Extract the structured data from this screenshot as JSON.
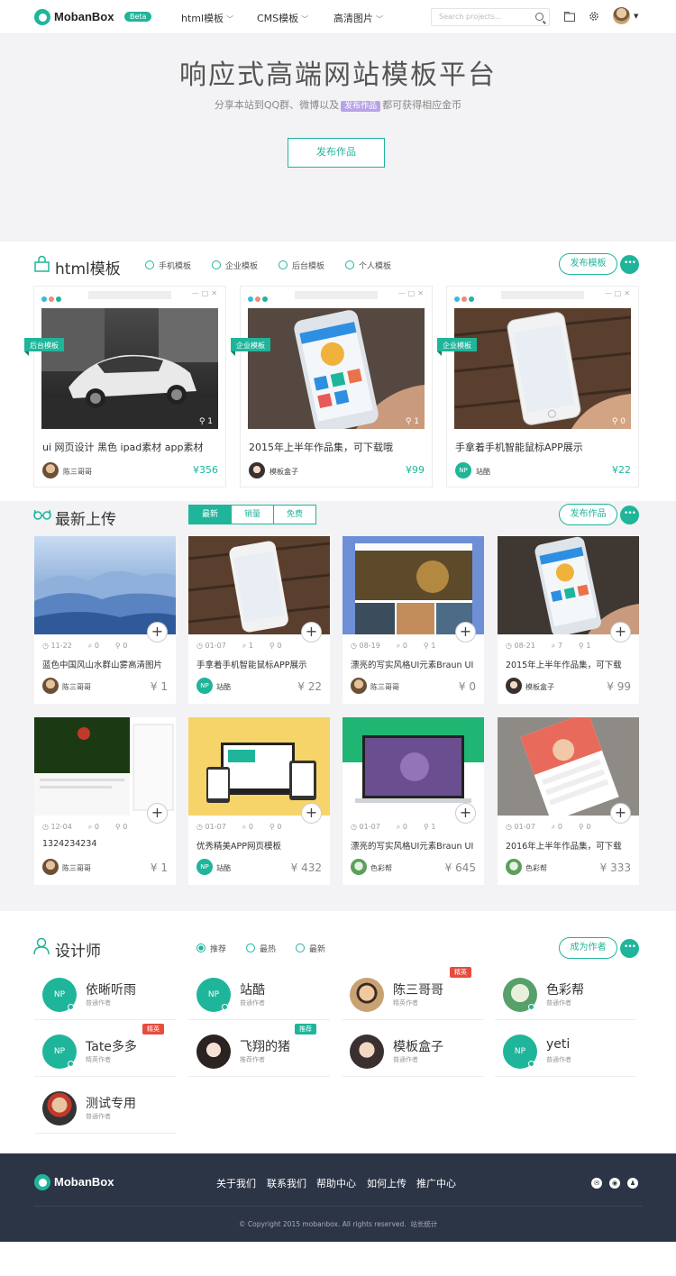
{
  "header": {
    "brand": "MobanBox",
    "beta": "Beta",
    "nav": [
      {
        "label": "html模板"
      },
      {
        "label": "CMS模板"
      },
      {
        "label": "高清图片"
      }
    ],
    "search_placeholder": "Search projects..."
  },
  "hero": {
    "title": "响应式高端网站模板平台",
    "sub_before": "分享本站到QQ群、微博以及",
    "sub_tag": "发布作品",
    "sub_after": "都可获得相应金币",
    "button": "发布作品"
  },
  "templates": {
    "title": "html模板",
    "filters": [
      "手机模板",
      "企业模板",
      "后台模板",
      "个人模板"
    ],
    "button": "发布模板",
    "more": "•••",
    "cards": [
      {
        "ribbon": "后台模板",
        "likes": "1",
        "title": "ui 网页设计 黑色 ipad素材 app素材",
        "author": "陈三哥哥",
        "price": "¥356"
      },
      {
        "ribbon": "企业模板",
        "likes": "1",
        "title": "2015年上半年作品集，可下载哦",
        "author": "模板盒子",
        "price": "¥99"
      },
      {
        "ribbon": "企业模板",
        "likes": "0",
        "title": "手拿着手机智能鼠标APP展示",
        "author": "站酷",
        "avatar": "NP",
        "price": "¥22"
      }
    ]
  },
  "latest": {
    "title": "最新上传",
    "tabs": [
      "最新",
      "销量",
      "免费"
    ],
    "button": "发布作品",
    "more": "•••",
    "cards": [
      {
        "date": "11-22",
        "comments": "0",
        "likes": "0",
        "title": "蓝色中国风山水群山雾高清图片",
        "author": "陈三哥哥",
        "price": "¥ 1"
      },
      {
        "date": "01-07",
        "comments": "1",
        "likes": "0",
        "title": "手拿着手机智能鼠标APP展示",
        "author": "站酷",
        "avatar": "NP",
        "price": "¥ 22"
      },
      {
        "date": "08-19",
        "comments": "0",
        "likes": "1",
        "title": "漂亮的写实风格UI元素Braun UI",
        "author": "陈三哥哥",
        "price": "¥ 0"
      },
      {
        "date": "08-21",
        "comments": "7",
        "likes": "1",
        "title": "2015年上半年作品集，可下载",
        "author": "模板盒子",
        "price": "¥ 99"
      },
      {
        "date": "12-04",
        "comments": "0",
        "likes": "0",
        "title": "1324234234",
        "author": "陈三哥哥",
        "price": "¥ 1"
      },
      {
        "date": "01-07",
        "comments": "0",
        "likes": "0",
        "title": "优秀精美APP网页模板",
        "author": "站酷",
        "avatar": "NP",
        "price": "¥ 432"
      },
      {
        "date": "01-07",
        "comments": "0",
        "likes": "1",
        "title": "漂亮的写实风格UI元素Braun UI",
        "author": "色彩帮",
        "price": "¥ 645"
      },
      {
        "date": "01-07",
        "comments": "0",
        "likes": "0",
        "title": "2016年上半年作品集，可下载",
        "author": "色彩帮",
        "price": "¥ 333"
      }
    ]
  },
  "designers": {
    "title": "设计师",
    "filters": [
      "推荐",
      "最热",
      "最新"
    ],
    "button": "成为作者",
    "more": "•••",
    "list": [
      {
        "name": "依晰听雨",
        "role": "普通作者",
        "avatar": "NP"
      },
      {
        "name": "站酷",
        "role": "普通作者",
        "avatar": "NP"
      },
      {
        "name": "陈三哥哥",
        "role": "精英作者",
        "tag": "精英"
      },
      {
        "name": "色彩帮",
        "role": "普通作者"
      },
      {
        "name": "Tate多多",
        "role": "精英作者",
        "avatar": "NP",
        "tag": "精英"
      },
      {
        "name": "飞翔的猪",
        "role": "推荐作者",
        "tag": "推荐"
      },
      {
        "name": "模板盒子",
        "role": "普通作者"
      },
      {
        "name": "yeti",
        "role": "普通作者",
        "avatar": "NP"
      },
      {
        "name": "测试专用",
        "role": "普通作者"
      }
    ]
  },
  "footer": {
    "brand": "MobanBox",
    "links": [
      "关于我们",
      "联系我们",
      "帮助中心",
      "如何上传",
      "推广中心"
    ],
    "copyright": "© Copyright 2015 mobanbox. All rights reserved.",
    "stats": "站长统计"
  },
  "colors": {
    "accent": "#1fb59a",
    "footer": "#2c3545",
    "hero_bg": "#f3f3f5",
    "tag_red": "#e74c3c",
    "tag_purple": "#b8a3e8"
  }
}
